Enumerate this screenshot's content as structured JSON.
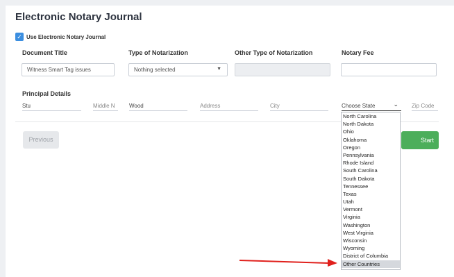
{
  "page": {
    "title": "Electronic Notary Journal"
  },
  "use_journal": {
    "label": "Use Electronic Notary Journal",
    "checked": true,
    "check_glyph": "✓"
  },
  "columns": {
    "document_title": "Document Title",
    "type_of_notarization": "Type of Notarization",
    "other_type": "Other Type of Notarization",
    "notary_fee": "Notary Fee"
  },
  "fields": {
    "document_title_value": "Witness Smart Tag issues",
    "type_of_notarization_value": "Nothing selected",
    "caret": "▼",
    "other_type_value": "",
    "notary_fee_value": ""
  },
  "principal": {
    "heading": "Principal Details",
    "first_name": "Stu",
    "middle_name_placeholder": "Middle N",
    "last_name": "Wood",
    "address_placeholder": "Address",
    "city_placeholder": "City",
    "state_label": "Choose State",
    "state_caret": "⌄",
    "zip_placeholder": "Zip Code"
  },
  "state_options": [
    "North Carolina",
    "North Dakota",
    "Ohio",
    "Oklahoma",
    "Oregon",
    "Pennsylvania",
    "Rhode Island",
    "South Carolina",
    "South Dakota",
    "Tennessee",
    "Texas",
    "Utah",
    "Vermont",
    "Virginia",
    "Washington",
    "West Virginia",
    "Wisconsin",
    "Wyoming",
    "District of Columbia",
    "Other Countries"
  ],
  "highlighted_option": "Other Countries",
  "buttons": {
    "previous": "Previous",
    "start_tagging": "Start Tagging"
  },
  "colors": {
    "accent": "#3b8ee0",
    "start_button": "#4cae5b",
    "annotation_arrow": "#e0201c"
  }
}
